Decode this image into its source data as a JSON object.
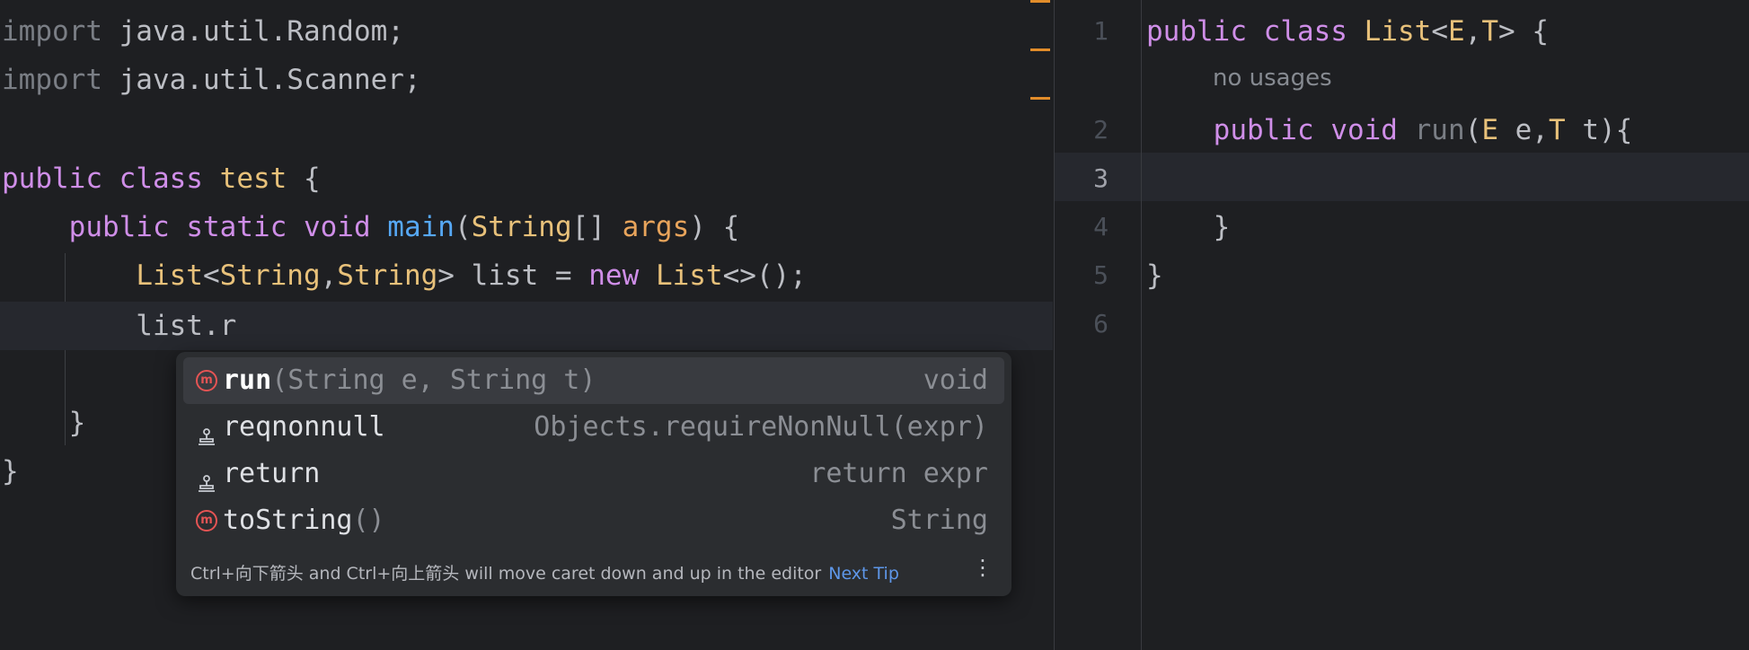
{
  "left_editor": {
    "lines": [
      {
        "t": [
          [
            "kw0",
            "import"
          ],
          [
            "p",
            " java.util.Random;"
          ]
        ]
      },
      {
        "t": [
          [
            "kw0",
            "import"
          ],
          [
            "p",
            " java.util.Scanner;"
          ]
        ]
      },
      {
        "t": []
      },
      {
        "t": [
          [
            "kw",
            "public"
          ],
          [
            "p",
            " "
          ],
          [
            "kw",
            "class"
          ],
          [
            "p",
            " "
          ],
          [
            "ty",
            "test"
          ],
          [
            "p",
            " {"
          ]
        ]
      },
      {
        "t": [
          [
            "p",
            "    "
          ],
          [
            "kw",
            "public"
          ],
          [
            "p",
            " "
          ],
          [
            "kw",
            "static"
          ],
          [
            "p",
            " "
          ],
          [
            "kw",
            "void"
          ],
          [
            "p",
            " "
          ],
          [
            "fn",
            "main"
          ],
          [
            "p",
            "("
          ],
          [
            "ty",
            "String"
          ],
          [
            "p",
            "[] "
          ],
          [
            "pa",
            "args"
          ],
          [
            "p",
            ") {"
          ]
        ]
      },
      {
        "t": [
          [
            "p",
            "        "
          ],
          [
            "ty",
            "List"
          ],
          [
            "p",
            "<"
          ],
          [
            "ty",
            "String"
          ],
          [
            "p",
            ","
          ],
          [
            "ty",
            "String"
          ],
          [
            "p",
            "> list = "
          ],
          [
            "kw",
            "new"
          ],
          [
            "p",
            " "
          ],
          [
            "ty",
            "List"
          ],
          [
            "p",
            "<>();"
          ]
        ]
      },
      {
        "t": [
          [
            "p",
            "        list.r"
          ]
        ]
      },
      {
        "t": []
      },
      {
        "t": [
          [
            "p",
            "    }"
          ]
        ]
      },
      {
        "t": [
          [
            "p",
            "}"
          ]
        ]
      }
    ]
  },
  "right_editor": {
    "line_numbers": [
      "1",
      "2",
      "3",
      "4",
      "5",
      "6"
    ],
    "inlay_hint": "no usages",
    "lines": [
      {
        "t": [
          [
            "kw",
            "public"
          ],
          [
            "p",
            " "
          ],
          [
            "kw",
            "class"
          ],
          [
            "p",
            " "
          ],
          [
            "ty",
            "List"
          ],
          [
            "p",
            "<"
          ],
          [
            "ty",
            "E"
          ],
          [
            "p",
            ","
          ],
          [
            "ty",
            "T"
          ],
          [
            "p",
            "> {"
          ]
        ]
      },
      {
        "t": [
          [
            "p",
            "    "
          ],
          [
            "kw",
            "public"
          ],
          [
            "p",
            " "
          ],
          [
            "kw",
            "void"
          ],
          [
            "p",
            " "
          ],
          [
            "gy",
            "run"
          ],
          [
            "p",
            "("
          ],
          [
            "ty",
            "E"
          ],
          [
            "p",
            " e,"
          ],
          [
            "ty",
            "T"
          ],
          [
            "p",
            " t){"
          ]
        ]
      },
      {
        "t": []
      },
      {
        "t": [
          [
            "p",
            "    }"
          ]
        ]
      },
      {
        "t": [
          [
            "p",
            "}"
          ]
        ]
      },
      {
        "t": []
      }
    ]
  },
  "completion": {
    "items": [
      {
        "icon": "method",
        "label": "run",
        "params": "(String e, String t)",
        "tail": "void"
      },
      {
        "icon": "template",
        "label": "reqnonnull",
        "params": "",
        "tail": "Objects.requireNonNull(expr)"
      },
      {
        "icon": "template",
        "label": "return",
        "params": "",
        "tail": "return expr"
      },
      {
        "icon": "method",
        "label": "toString",
        "params": "()",
        "tail": "String"
      }
    ],
    "hint_text": "Ctrl+向下箭头 and Ctrl+向上箭头 will move caret down and up in the editor",
    "next_tip": "Next Tip",
    "menu_glyph": "⋮",
    "method_glyph": "m"
  }
}
